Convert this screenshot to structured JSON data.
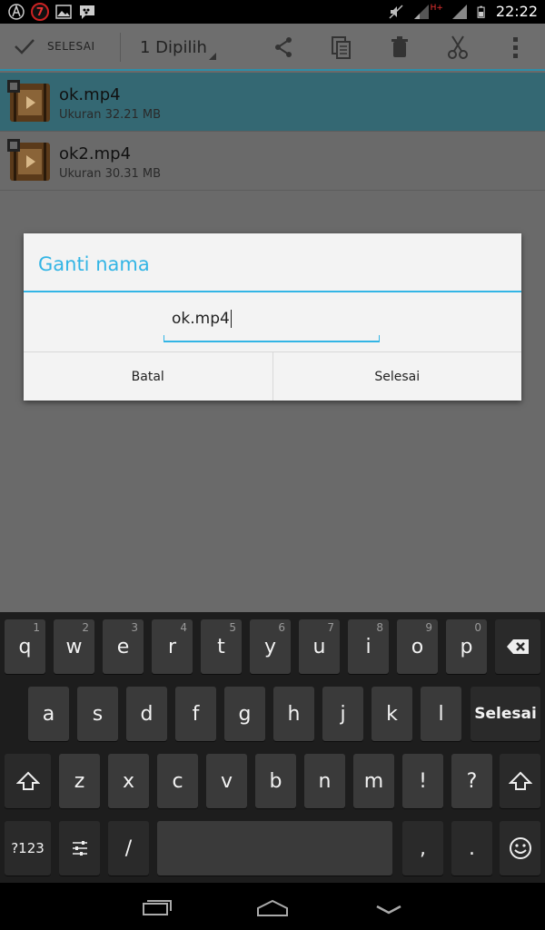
{
  "status_bar": {
    "notification_count": "7",
    "network": "H+",
    "time": "22:22"
  },
  "action_bar": {
    "done_label": "SELESAI",
    "selection_label": "1 Dipilih"
  },
  "files": [
    {
      "name": "ok.mp4",
      "size": "Ukuran 32.21 MB",
      "selected": true
    },
    {
      "name": "ok2.mp4",
      "size": "Ukuran 30.31 MB",
      "selected": false
    }
  ],
  "dialog": {
    "title": "Ganti nama",
    "input_value": "ok.mp4",
    "cancel_label": "Batal",
    "confirm_label": "Selesai"
  },
  "keyboard": {
    "row1": [
      {
        "key": "q",
        "hint": "1"
      },
      {
        "key": "w",
        "hint": "2"
      },
      {
        "key": "e",
        "hint": "3"
      },
      {
        "key": "r",
        "hint": "4"
      },
      {
        "key": "t",
        "hint": "5"
      },
      {
        "key": "y",
        "hint": "6"
      },
      {
        "key": "u",
        "hint": "7"
      },
      {
        "key": "i",
        "hint": "8"
      },
      {
        "key": "o",
        "hint": "9"
      },
      {
        "key": "p",
        "hint": "0"
      }
    ],
    "row2": [
      "a",
      "s",
      "d",
      "f",
      "g",
      "h",
      "j",
      "k",
      "l"
    ],
    "row3": [
      "z",
      "x",
      "c",
      "v",
      "b",
      "n",
      "m",
      "!",
      "?"
    ],
    "done_label": "Selesai",
    "symbols_label": "?123",
    "slash_label": "/",
    "comma_label": ",",
    "period_label": "."
  },
  "colors": {
    "accent": "#33b5e5",
    "selected_row": "#346873"
  }
}
